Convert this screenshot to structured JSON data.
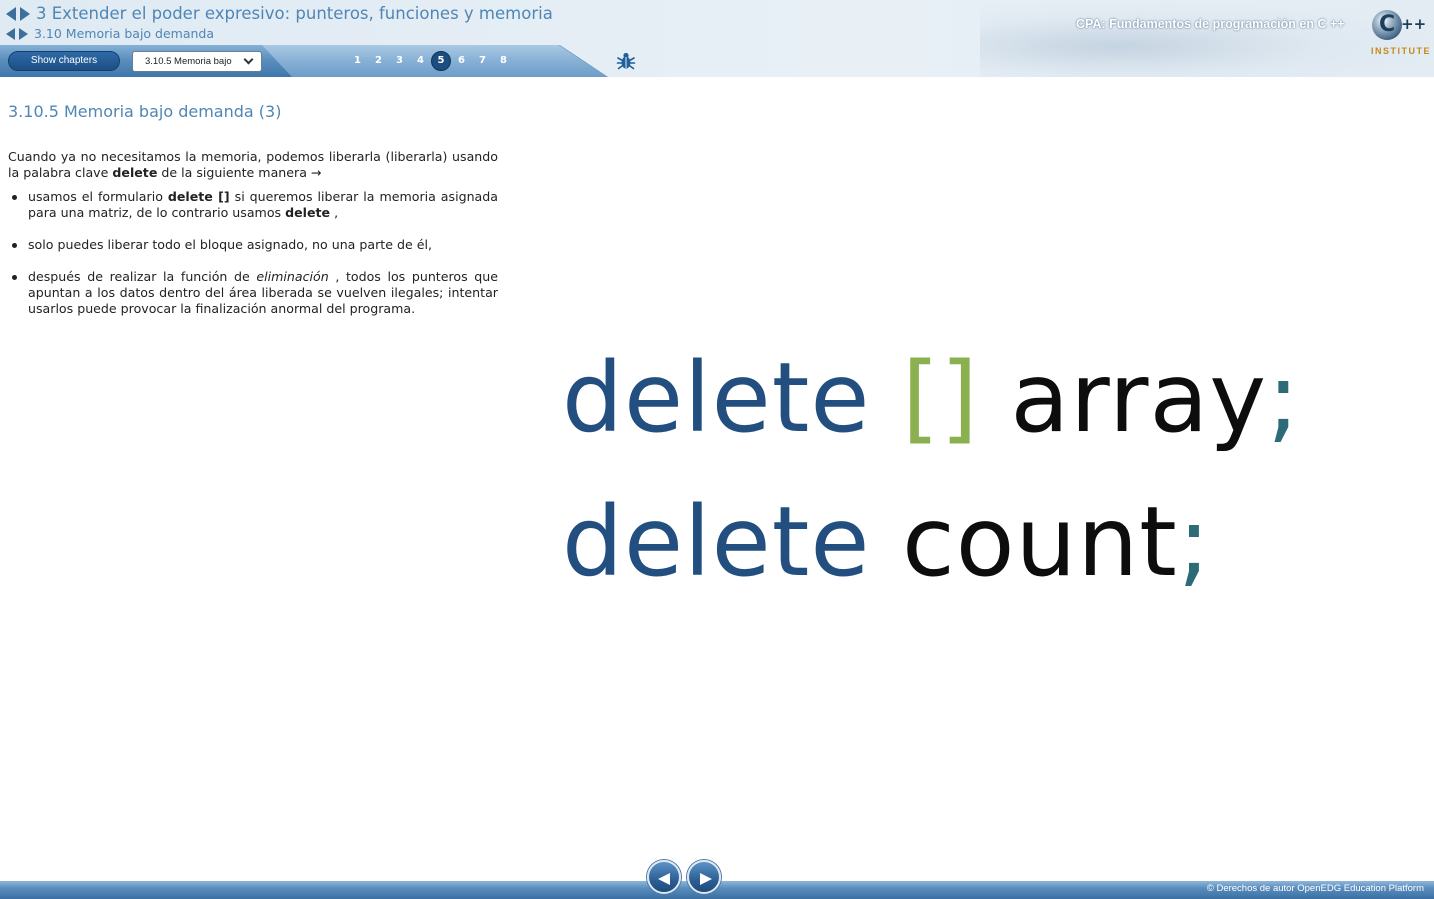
{
  "header": {
    "chapter_title": "3 Extender el poder expresivo: punteros, funciones y memoria",
    "section_title": "3.10 Memoria bajo demanda",
    "course_title": "CPA: Fundamentos de programación en C ++",
    "logo": {
      "mark": "C",
      "suffix": "++",
      "tagline": "INSTITUTE"
    }
  },
  "toolbar": {
    "show_chapters_label": "Show chapters",
    "section_select_value": "3.10.5 Memoria bajo",
    "pages": [
      "1",
      "2",
      "3",
      "4",
      "5",
      "6",
      "7",
      "8"
    ],
    "active_page": "5",
    "bug_icon": "bug-icon"
  },
  "content": {
    "heading": "3.10.5 Memoria bajo demanda (3)",
    "intro": {
      "before": "Cuando ya no necesitamos la memoria, podemos liberarla (liberarla) usando la palabra clave ",
      "keyword": "delete",
      "after": " de la siguiente manera →"
    },
    "bullets": [
      {
        "t1": "usamos el formulario ",
        "b1": "delete []",
        "t2": " si queremos liberar la memoria asignada para una matriz, de lo contrario usamos ",
        "b2": "delete",
        "t3": " ,"
      },
      {
        "text": "solo puedes liberar todo el bloque asignado, no una parte de él,"
      },
      {
        "t1": "después de realizar la función de ",
        "i1": "eliminación",
        "t2": " , todos los punteros que apuntan a los datos dentro del área liberada se vuelven ilegales; intentar usarlos puede provocar la finalización anormal del programa."
      }
    ],
    "code": {
      "line1": {
        "keyword": "delete",
        "brackets": "[]",
        "identifier": "array",
        "semicolon": ";"
      },
      "line2": {
        "keyword": "delete",
        "identifier": "count",
        "semicolon": ";"
      },
      "colors": {
        "keyword": "#234f80",
        "brackets": "#8ab050",
        "identifier": "#0d0d0d",
        "semicolon": "#2e6b79"
      }
    }
  },
  "footer": {
    "copyright": "© Derechos de autor OpenEDG Education Platform",
    "prev_icon": "arrow-left-icon",
    "next_icon": "arrow-right-icon"
  }
}
